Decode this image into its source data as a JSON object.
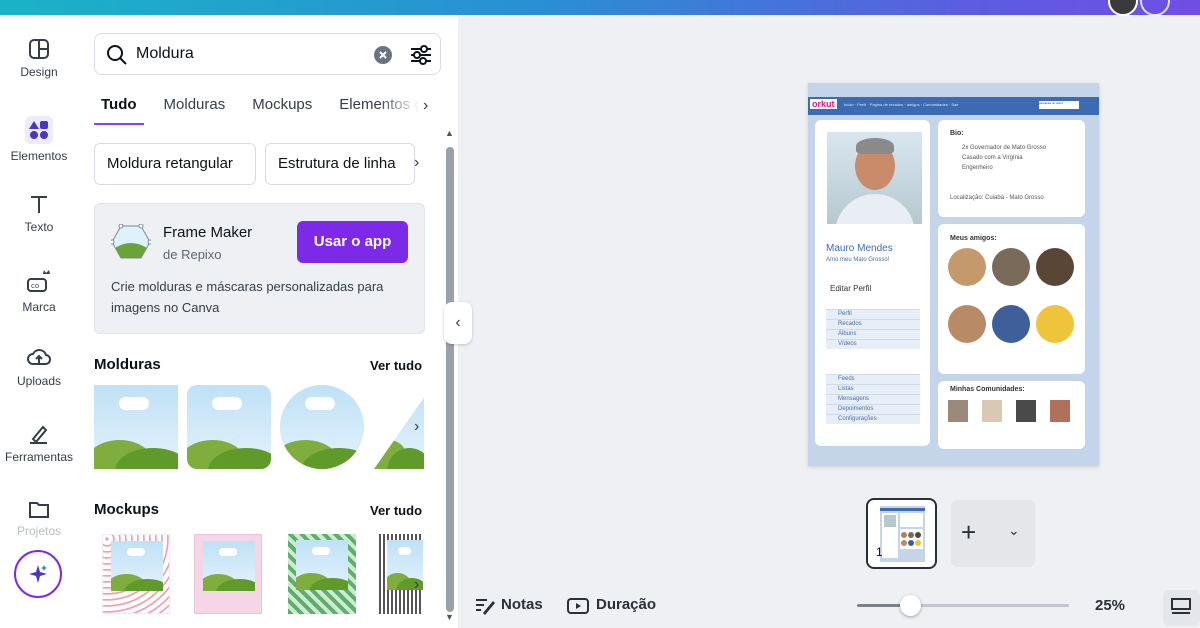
{
  "rail": {
    "items": [
      {
        "label": "Design"
      },
      {
        "label": "Elementos"
      },
      {
        "label": "Texto"
      },
      {
        "label": "Marca"
      },
      {
        "label": "Uploads"
      },
      {
        "label": "Ferramentas"
      },
      {
        "label": "Projetos"
      }
    ]
  },
  "panel": {
    "search": {
      "value": "Moldura"
    },
    "tabs": [
      "Tudo",
      "Molduras",
      "Mockups",
      "Elementos gr"
    ],
    "chips": [
      "Moldura retangular",
      "Estrutura de linha"
    ],
    "app": {
      "title": "Frame Maker",
      "subtitle": "de Repixo",
      "button": "Usar o app",
      "description": "Crie molduras e máscaras personalizadas para imagens no Canva"
    },
    "sections": [
      {
        "title": "Molduras",
        "link": "Ver tudo"
      },
      {
        "title": "Mockups",
        "link": "Ver tudo"
      }
    ]
  },
  "canvas": {
    "orkut": {
      "logo": "orkut",
      "links": "Início · Perfil · Página de recados · amigos · Comunidades · Sair",
      "search": "pesquisa no orkut",
      "bio_title": "Bio:",
      "bio_lines": [
        "2x Governador de Mato Grosso",
        "Casado com a Virgínia",
        "Engenheiro"
      ],
      "location": "Localização: Cuiabá - Mato Grosso",
      "name": "Mauro Mendes",
      "tagline": "Amo meu Mato Grosso!",
      "edit": "Editar Perfil",
      "menu1": [
        "Perfil",
        "Recados",
        "Álbuns",
        "Vídeos"
      ],
      "menu2": [
        "Feeds",
        "Listas",
        "Mensagens",
        "Depoimentos",
        "Configurações"
      ],
      "friends_title": "Meus amigos:",
      "communities_title": "Minhas Comunidades:"
    }
  },
  "pages": {
    "current": "1"
  },
  "bottom": {
    "notes": "Notas",
    "duration": "Duração",
    "zoom": "25%",
    "zoom_fraction": 0.25
  }
}
